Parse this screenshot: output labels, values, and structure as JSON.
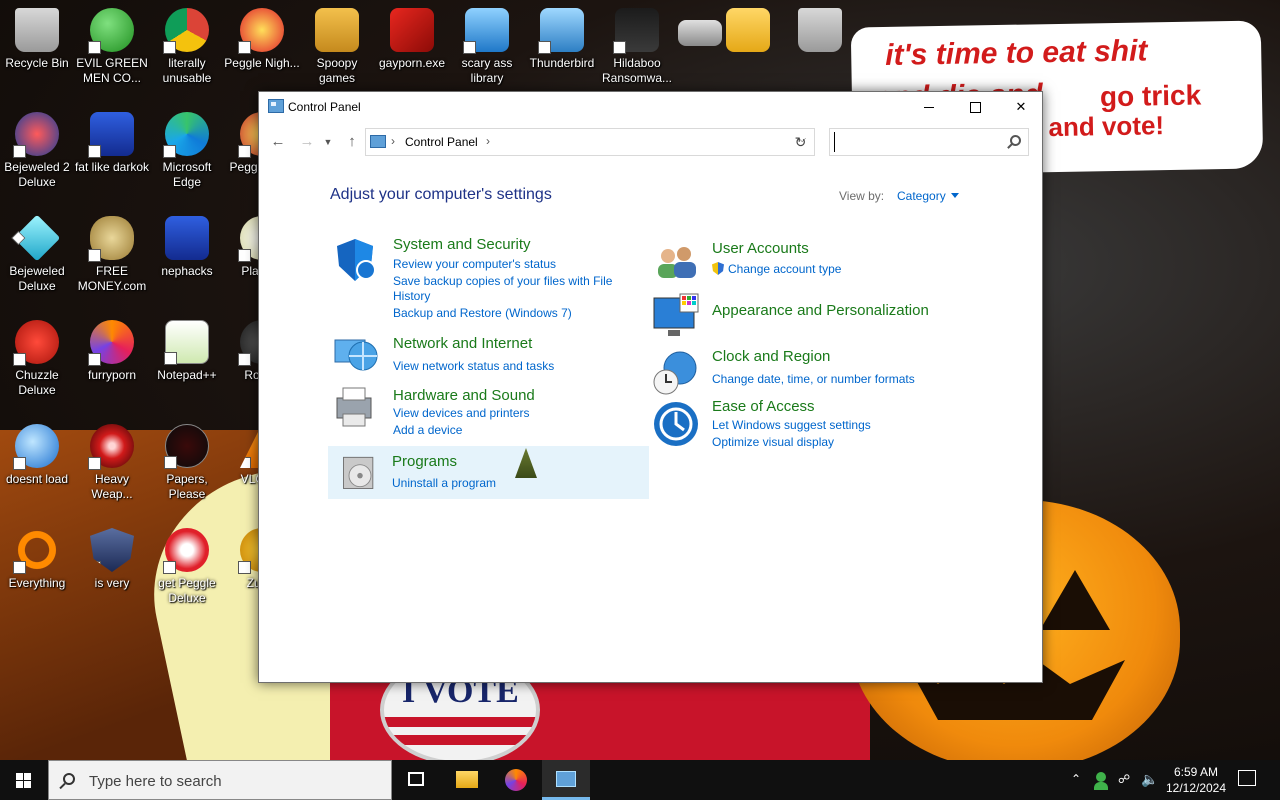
{
  "wallpaper": {
    "bubble_line1": "it's time to eat shit",
    "bubble_line2": "and die and",
    "bubble_line2b": "go trick",
    "bubble_line3": "and vote!",
    "pin_text": "I VOTE"
  },
  "desktop_icons": [
    {
      "label": "Recycle Bin"
    },
    {
      "label": "EVIL GREEN MEN CO..."
    },
    {
      "label": "literally unusable"
    },
    {
      "label": "Peggle Nigh..."
    },
    {
      "label": "Spoopy games"
    },
    {
      "label": "gayporn.exe"
    },
    {
      "label": "scary ass library"
    },
    {
      "label": "Thunderbird"
    },
    {
      "label": "Hildaboo Ransomwa..."
    },
    {
      "label": "Bejeweled 2 Deluxe"
    },
    {
      "label": "fat like darkok"
    },
    {
      "label": "Microsoft Edge"
    },
    {
      "label": "Peggl of Wa"
    },
    {
      "label": "Bejeweled Deluxe"
    },
    {
      "label": "FREE MONEY.com"
    },
    {
      "label": "nephacks"
    },
    {
      "label": "Pla Zon"
    },
    {
      "label": "Chuzzle Deluxe"
    },
    {
      "label": "furryporn"
    },
    {
      "label": "Notepad++"
    },
    {
      "label": "Ro Ma"
    },
    {
      "label": "doesnt load"
    },
    {
      "label": "Heavy Weap..."
    },
    {
      "label": "Papers, Please"
    },
    {
      "label": "VLC pla"
    },
    {
      "label": "Everything"
    },
    {
      "label": "is very"
    },
    {
      "label": "get Peggle Deluxe"
    },
    {
      "label": "Zuma"
    }
  ],
  "window": {
    "title": "Control Panel",
    "address_crumb": "Control Panel",
    "search_placeholder": "",
    "heading": "Adjust your computer's settings",
    "view_by_label": "View by:",
    "view_by_value": "Category",
    "categories": [
      {
        "title": "System and Security",
        "links": [
          "Review your computer's status",
          "Save backup copies of your files with File",
          "History",
          "Backup and Restore (Windows 7)"
        ]
      },
      {
        "title": "Network and Internet",
        "links": [
          "View network status and tasks"
        ]
      },
      {
        "title": "Hardware and Sound",
        "links": [
          "View devices and printers",
          "Add a device"
        ]
      },
      {
        "title": "Programs",
        "links": [
          "Uninstall a program"
        ]
      },
      {
        "title": "User Accounts",
        "links": [
          "Change account type"
        ]
      },
      {
        "title": "Appearance and Personalization",
        "links": []
      },
      {
        "title": "Clock and Region",
        "links": [
          "Change date, time, or number formats"
        ]
      },
      {
        "title": "Ease of Access",
        "links": [
          "Let Windows suggest settings",
          "Optimize visual display"
        ]
      }
    ]
  },
  "taskbar": {
    "search_placeholder": "Type here to search",
    "time": "6:59 AM",
    "date": "12/12/2024"
  },
  "colors": {
    "heading": "#1e3287",
    "category_title": "#1a7a1a",
    "link": "#0066cc",
    "highlight": "#e5f3fb",
    "taskbar": "#101010"
  }
}
